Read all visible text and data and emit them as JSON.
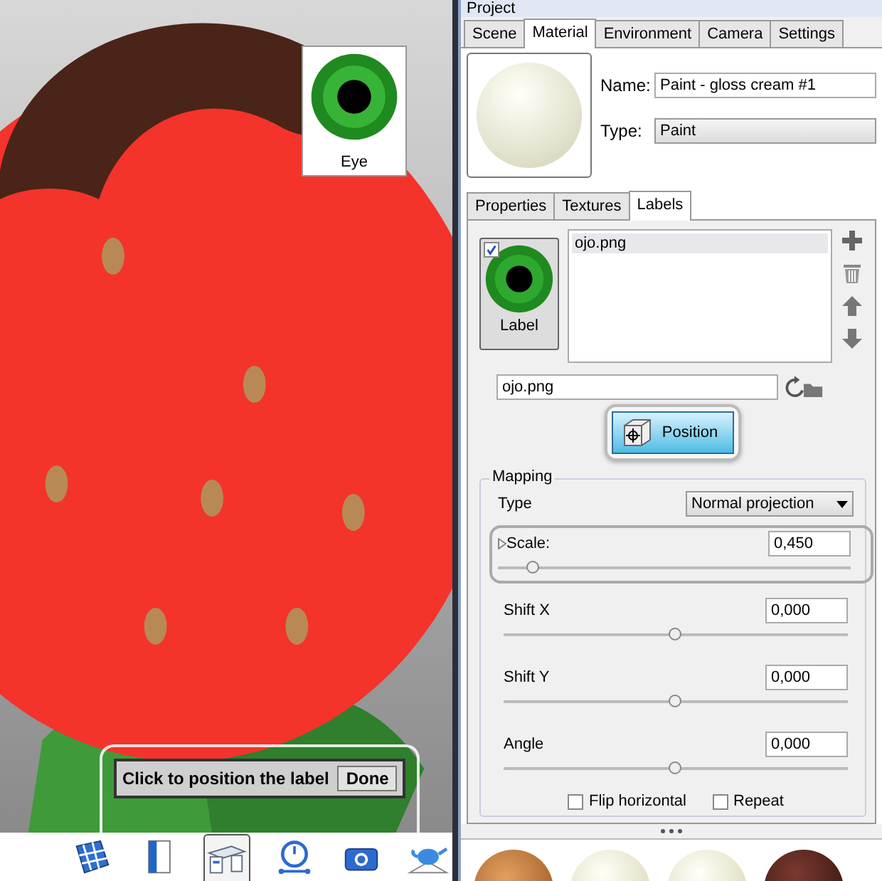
{
  "viewport": {
    "label_preview": {
      "caption": "Eye"
    },
    "hint": {
      "text": "Click to position the label",
      "button": "Done"
    },
    "toolbar": [
      {
        "kind": "surface",
        "selected": false
      },
      {
        "kind": "binder",
        "selected": false
      },
      {
        "kind": "desk",
        "selected": true
      },
      {
        "kind": "timer",
        "selected": false
      },
      {
        "kind": "camera",
        "selected": false
      },
      {
        "kind": "teapot",
        "selected": false
      }
    ]
  },
  "panel": {
    "title": "Project",
    "tabs": [
      {
        "label": "Scene",
        "selected": false
      },
      {
        "label": "Material",
        "selected": true
      },
      {
        "label": "Environment",
        "selected": false
      },
      {
        "label": "Camera",
        "selected": false
      },
      {
        "label": "Settings",
        "selected": false
      }
    ],
    "material": {
      "name_label": "Name:",
      "name": "Paint - gloss cream #1",
      "type_label": "Type:",
      "type": "Paint"
    },
    "subtabs": [
      {
        "label": "Properties",
        "selected": false
      },
      {
        "label": "Textures",
        "selected": false
      },
      {
        "label": "Labels",
        "selected": true
      }
    ],
    "labels": {
      "thumb_caption": "Label",
      "checked": true,
      "files": [
        {
          "name": "ojo.png",
          "selected": true
        }
      ],
      "path": "ojo.png",
      "position_button": "Position"
    },
    "mapping": {
      "title": "Mapping",
      "type_label": "Type",
      "type": "Normal projection",
      "params": [
        {
          "label": "Scale:",
          "value": "0,450",
          "level": 0.1,
          "highlighted": true
        },
        {
          "label": "Shift X",
          "value": "0,000",
          "level": 0.5,
          "highlighted": false
        },
        {
          "label": "Shift Y",
          "value": "0,000",
          "level": 0.5,
          "highlighted": false
        },
        {
          "label": "Angle",
          "value": "0,000",
          "level": 0.5,
          "highlighted": false
        }
      ],
      "checkboxes": [
        {
          "label": "Flip horizontal",
          "checked": false
        },
        {
          "label": "Repeat",
          "checked": false
        }
      ]
    },
    "swatches": [
      {
        "kind": "wood"
      },
      {
        "kind": "cream"
      },
      {
        "kind": "cream"
      },
      {
        "kind": "chocolate"
      }
    ]
  }
}
